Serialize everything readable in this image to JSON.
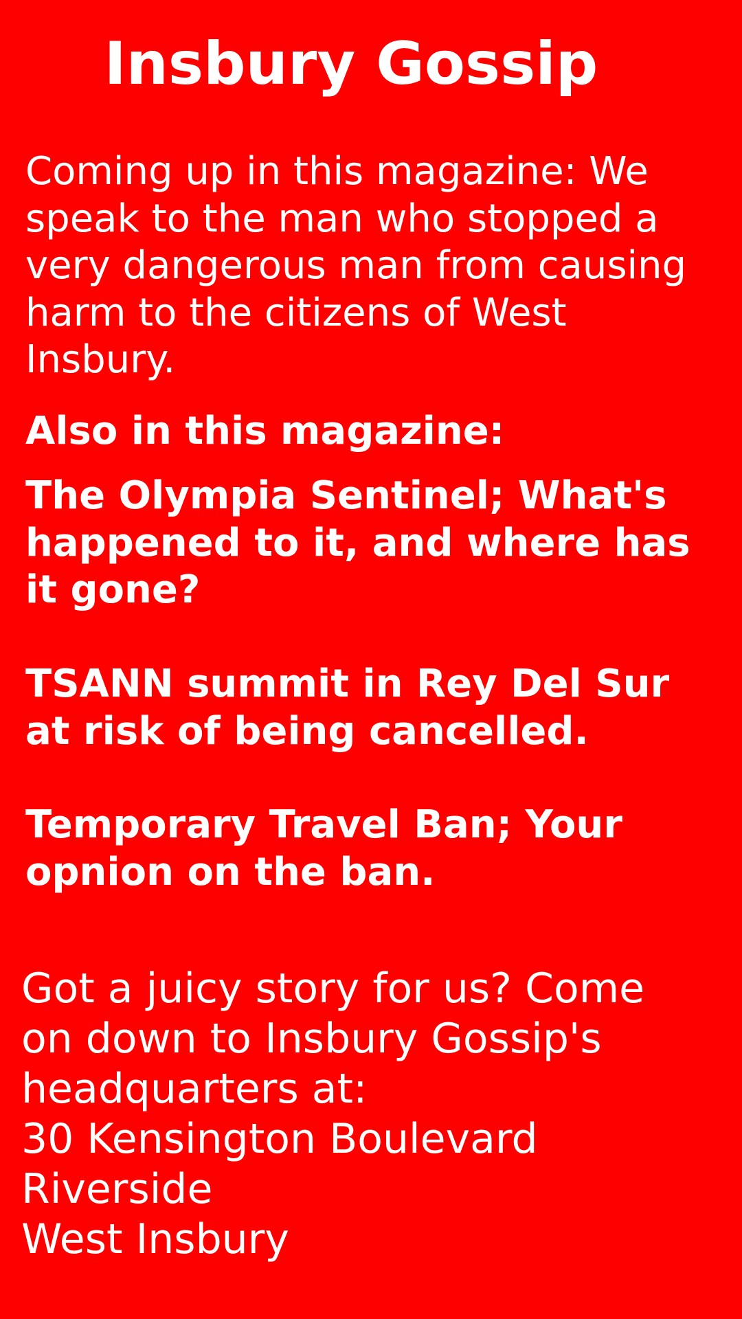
{
  "title": "Insbury Gossip",
  "intro": "Coming up in this magazine: We speak to the man who stopped a very dangerous man from causing harm to the citizens of West Insbury.",
  "also_heading": "Also in this magazine:",
  "items": [
    "The Olympia Sentinel; What's happened to it, and where has it gone?",
    "TSANN summit in Rey Del Sur at risk of being cancelled.",
    "Temporary Travel Ban; Your opnion on the ban."
  ],
  "contact": {
    "line1": "Got a juicy story for us? Come",
    "line2": "on down to Insbury Gossip's",
    "line3": "headquarters at:",
    "address": [
      "30 Kensington Boulevard",
      "Riverside",
      "West Insbury"
    ]
  }
}
